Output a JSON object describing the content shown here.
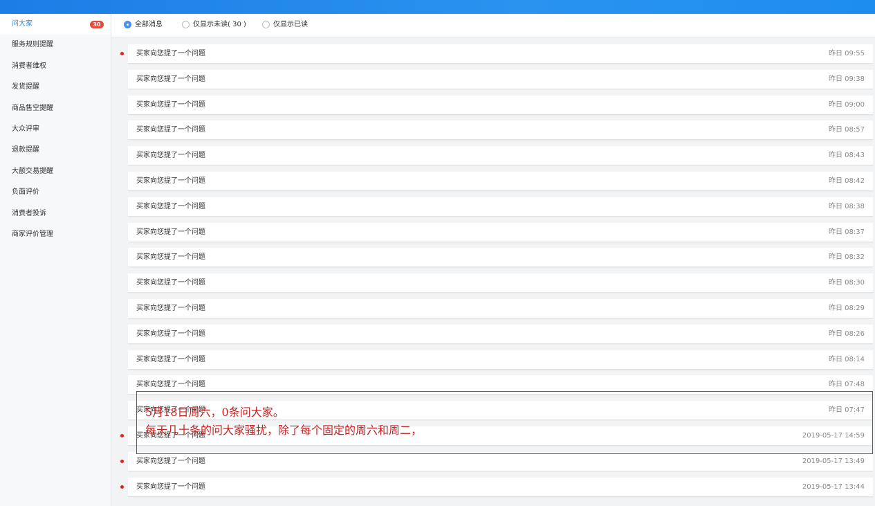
{
  "sidebar": {
    "items": [
      {
        "label": "问大家",
        "badge": "30",
        "active": true,
        "name": "sidebar-item-ask-everyone"
      },
      {
        "label": "服务规则提醒",
        "name": "sidebar-item-service-rules"
      },
      {
        "label": "消费者维权",
        "name": "sidebar-item-consumer-rights"
      },
      {
        "label": "发货提醒",
        "name": "sidebar-item-shipping-reminder"
      },
      {
        "label": "商品售空提醒",
        "name": "sidebar-item-sold-out-reminder"
      },
      {
        "label": "大众评审",
        "name": "sidebar-item-public-review"
      },
      {
        "label": "退款提醒",
        "name": "sidebar-item-refund-reminder"
      },
      {
        "label": "大额交易提醒",
        "name": "sidebar-item-large-transaction"
      },
      {
        "label": "负面评价",
        "name": "sidebar-item-negative-review"
      },
      {
        "label": "消费者投诉",
        "name": "sidebar-item-consumer-complaint"
      },
      {
        "label": "商家评价管理",
        "name": "sidebar-item-merchant-review"
      }
    ]
  },
  "filters": {
    "all": "全部消息",
    "unread": "仅显示未读( 30 )",
    "read": "仅显示已读",
    "selected": "all"
  },
  "messages": [
    {
      "title": "买家向您提了一个问题",
      "time": "昨日 09:55",
      "unread": true
    },
    {
      "title": "买家向您提了一个问题",
      "time": "昨日 09:38",
      "unread": false
    },
    {
      "title": "买家向您提了一个问题",
      "time": "昨日 09:00",
      "unread": false
    },
    {
      "title": "买家向您提了一个问题",
      "time": "昨日 08:57",
      "unread": false
    },
    {
      "title": "买家向您提了一个问题",
      "time": "昨日 08:43",
      "unread": false
    },
    {
      "title": "买家向您提了一个问题",
      "time": "昨日 08:42",
      "unread": false
    },
    {
      "title": "买家向您提了一个问题",
      "time": "昨日 08:38",
      "unread": false
    },
    {
      "title": "买家向您提了一个问题",
      "time": "昨日 08:37",
      "unread": false
    },
    {
      "title": "买家向您提了一个问题",
      "time": "昨日 08:32",
      "unread": false
    },
    {
      "title": "买家向您提了一个问题",
      "time": "昨日 08:30",
      "unread": false
    },
    {
      "title": "买家向您提了一个问题",
      "time": "昨日 08:29",
      "unread": false
    },
    {
      "title": "买家向您提了一个问题",
      "time": "昨日 08:26",
      "unread": false
    },
    {
      "title": "买家向您提了一个问题",
      "time": "昨日 08:14",
      "unread": false
    },
    {
      "title": "买家向您提了一个问题",
      "time": "昨日 07:48",
      "unread": false
    },
    {
      "title": "买家向您提了一个问题",
      "time": "昨日 07:47",
      "unread": false
    },
    {
      "title": "买家向您提了一个问题",
      "time": "2019-05-17 14:59",
      "unread": true
    },
    {
      "title": "买家向您提了一个问题",
      "time": "2019-05-17 13:49",
      "unread": true
    },
    {
      "title": "买家向您提了一个问题",
      "time": "2019-05-17 13:44",
      "unread": true
    }
  ],
  "annotation": {
    "line1": "5月18日周六，0条问大家。",
    "line2": "每天几十条的问大家骚扰，除了每个固定的周六和周二，",
    "color": "#c82020"
  },
  "colors": {
    "accent": "#2f8bd9",
    "badge": "#e44b3b",
    "unread_dot": "#e02020",
    "radio_checked": "#4a8df0",
    "topbar": "#1a7ee6"
  }
}
